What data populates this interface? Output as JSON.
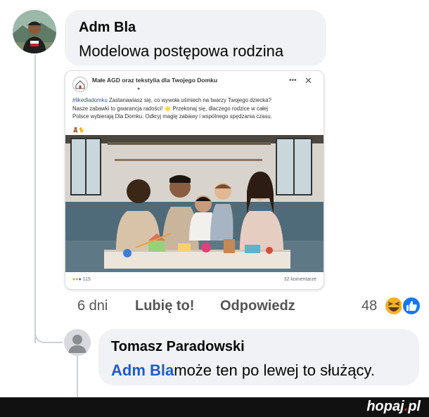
{
  "comment": {
    "author": "Adm Bla",
    "text": "Modelowa postępowa rodzina",
    "time": "6 dni",
    "like_label": "Lubię to!",
    "reply_label": "Odpowiedz",
    "reaction_count": "48",
    "reaction_icons": [
      "haha-icon",
      "like-icon"
    ]
  },
  "shared_post": {
    "page_name": "Małe AGD oraz tekstylia dla Twojego Domku",
    "hashtag": "#likedladomku",
    "text_lines": [
      " Zastanawiasz się, co wywoła uśmiech na twarzy Twojego dziecka?",
      "Nasze zabawki to gwarancja radości! 🌟 Przekonaj się, dlaczego rodzice w całej",
      "Polsce wybierają Dla Domku. Odkryj magię zabawy i wspólnego spędzania czasu."
    ],
    "emojis": "🧸🐈",
    "reaction_count": "115",
    "comments": "32 komentarze",
    "more_icon": "more-dots-icon",
    "close_icon": "close-icon"
  },
  "reply": {
    "author": "Tomasz Paradowski",
    "mention": "Adm Bla",
    "text": "może ten po lewej to służący."
  },
  "footer": {
    "brand_main": "hopaj",
    "brand_dot": ".",
    "brand_tld": "pl"
  },
  "colors": {
    "bubble": "#f0f2f5",
    "mention": "#1e5cc8",
    "like_blue": "#1877f2",
    "haha_yellow": "#f7b125"
  }
}
